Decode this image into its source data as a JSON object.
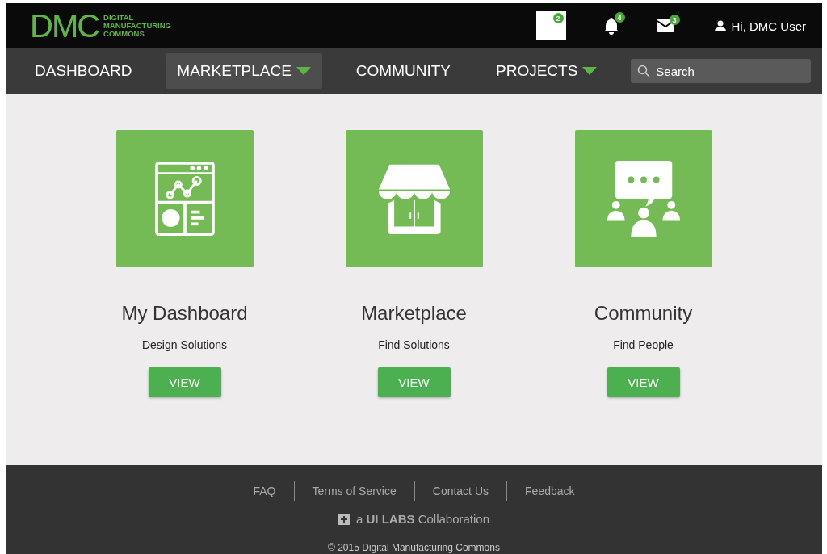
{
  "header": {
    "logo_mark": "DMC",
    "logo_text": [
      "DIGITAL",
      "MANUFACTURING",
      "COMMONS"
    ],
    "notifications": [
      {
        "kind": "blank",
        "count": "2"
      },
      {
        "kind": "bell",
        "count": "4"
      },
      {
        "kind": "mail",
        "count": "3"
      }
    ],
    "user": "Hi, DMC User"
  },
  "nav": {
    "items": [
      {
        "label": "DASHBOARD",
        "selected": false,
        "dropdown": false
      },
      {
        "label": "MARKETPLACE",
        "selected": true,
        "dropdown": true
      },
      {
        "label": "COMMUNITY",
        "selected": false,
        "dropdown": false
      },
      {
        "label": "PROJECTS",
        "selected": false,
        "dropdown": true
      }
    ],
    "search": {
      "placeholder": "Search"
    }
  },
  "cards": [
    {
      "kind": "dashboard",
      "title": "My Dashboard",
      "subtitle": "Design Solutions",
      "button": "VIEW"
    },
    {
      "kind": "store",
      "title": "Marketplace",
      "subtitle": "Find Solutions",
      "button": "VIEW"
    },
    {
      "kind": "community",
      "title": "Community",
      "subtitle": "Find People",
      "button": "VIEW"
    }
  ],
  "footer": {
    "links": [
      "FAQ",
      "Terms of Service",
      "Contact Us",
      "Feedback"
    ],
    "collaboration": "a **UI LABS** Collaboration",
    "copyright": "© 2015 Digital Manufacturing Commons"
  }
}
